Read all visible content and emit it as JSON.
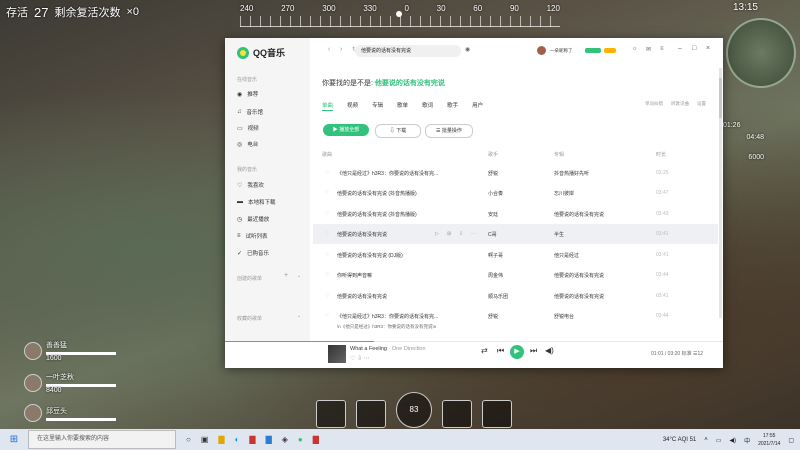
{
  "hud": {
    "alive_label": "存活",
    "alive_count": "27",
    "revive_label": "剩余复活次数",
    "revive_count": "×0",
    "compass": [
      "240",
      "270",
      "300",
      "330",
      "0",
      "30",
      "60",
      "90",
      "120"
    ],
    "clock": "13:15",
    "timer_label": "城寨区 01:26",
    "timer_value": "04:48",
    "coins": "6000",
    "players": [
      {
        "name": "善善猛",
        "score": "1600"
      },
      {
        "name": "一叶芝秋",
        "score": "8400"
      },
      {
        "name": "邱豆头",
        "score": ""
      }
    ],
    "skill_text": "83"
  },
  "app": {
    "name": "QQ音乐",
    "search_value": "他要说的话有没有完说",
    "user_name": "一朵昵称了",
    "sidebar": {
      "online_label": "在线音乐",
      "online_items": [
        "推荐",
        "音乐馆",
        "视频",
        "电台"
      ],
      "mine_label": "我的音乐",
      "mine_items": [
        "我喜欢",
        "本地和下载",
        "最近播放",
        "试听列表",
        "已购音乐"
      ],
      "created_label": "创建的歌单",
      "fav_label": "收藏的歌单"
    },
    "heading_prefix": "你要找的是不是:",
    "heading_query": "他要说的话有没有完说",
    "tabs": [
      "单曲",
      "视频",
      "专辑",
      "歌单",
      "歌词",
      "歌手",
      "用户"
    ],
    "right_links": [
      "单词纠错",
      "听歌识曲",
      "设置"
    ],
    "buttons": {
      "play_all": "播放全部",
      "download": "下载",
      "batch": "批量操作"
    },
    "columns": {
      "title": "歌曲",
      "artist": "歌手",
      "album": "专辑",
      "duration": "时长"
    },
    "songs": [
      {
        "title": "《他只是经过》h3R3：你要说的话有没有完...",
        "artist": "舒锐",
        "album": "抖音热播好先听",
        "duration": "03:25"
      },
      {
        "title": "他要说的话有没有完说 (抖音热播版)",
        "artist": "小合奏",
        "album": "忘川彼岸",
        "duration": "03:47"
      },
      {
        "title": "他要说的话有没有完说 (抖音热播版)",
        "artist": "安廷",
        "album": "他要说的话有没有完说",
        "duration": "03:43"
      },
      {
        "title": "他要说的话有没有完说",
        "artist": "C哥",
        "album": "半生",
        "duration": "03:41"
      },
      {
        "title": "他要说的话有没有完说 (DJ版)",
        "artist": "啊子哥",
        "album": "他只是经过",
        "duration": "03:41"
      },
      {
        "title": "你听得到声音嘛",
        "artist": "周金伟",
        "album": "他要说的话有没有完说",
        "duration": "03:44"
      },
      {
        "title": "他要说的话有没有完说",
        "artist": "顺马乐团",
        "album": "他要说的话有没有完说",
        "duration": "03:41"
      },
      {
        "title": "《他只是经过》h3R3：你要说的话有没有完...",
        "artist": "舒锐",
        "album": "舒锐电台",
        "duration": "03:44"
      }
    ],
    "lyric_snippet": "\\n《他只是经过》h3R3：你要说的话有没有完说\\n",
    "now_playing": {
      "title": "What a Feeling",
      "artist": "One Direction",
      "time": "01:01 / 03:20",
      "quality": "标准",
      "count": "12"
    }
  },
  "taskbar": {
    "search_placeholder": "在这里输入你要搜索的内容",
    "weather": "34°C AQI 51",
    "time": "17:55",
    "date": "2021/7/14",
    "lang": "中"
  }
}
